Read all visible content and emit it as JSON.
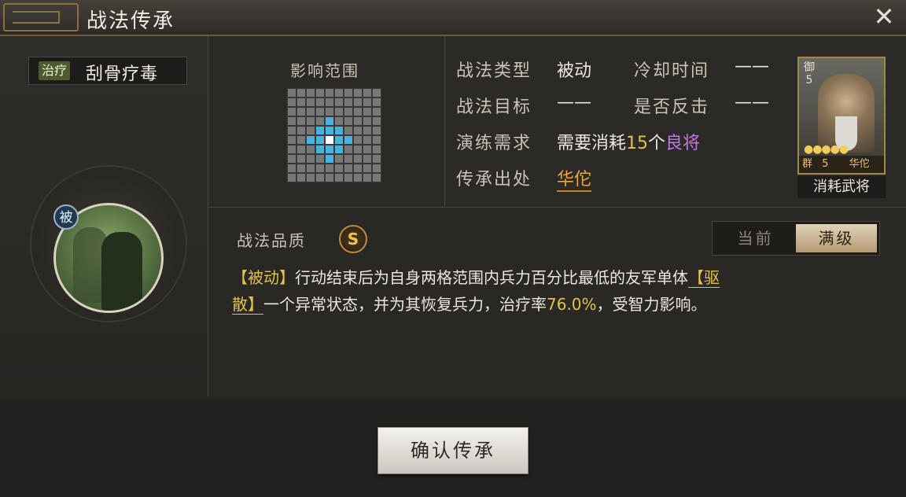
{
  "header": {
    "title": "战法传承"
  },
  "skill": {
    "tag": "治疗",
    "name": "刮骨疗毒",
    "passive_badge": "被"
  },
  "range": {
    "label": "影响范围",
    "grid_size": 10,
    "active_cells": [
      [
        3,
        4
      ],
      [
        4,
        3
      ],
      [
        4,
        4
      ],
      [
        4,
        5
      ],
      [
        5,
        2
      ],
      [
        5,
        3
      ],
      [
        5,
        5
      ],
      [
        5,
        6
      ],
      [
        6,
        3
      ],
      [
        6,
        4
      ],
      [
        6,
        5
      ],
      [
        7,
        4
      ]
    ],
    "center_cell": [
      5,
      4
    ]
  },
  "info": {
    "type_label": "战法类型",
    "type_value": "被动",
    "cooldown_label": "冷却时间",
    "cooldown_value": "——",
    "target_label": "战法目标",
    "target_value": "——",
    "counter_label": "是否反击",
    "counter_value": "——",
    "practice_label": "演练需求",
    "practice_prefix": "需要消耗",
    "practice_count": "15",
    "practice_unit": "个",
    "practice_item": "良将",
    "source_label": "传承出处",
    "source_value": "华佗"
  },
  "card": {
    "top_label": "御",
    "top_number": "5",
    "stars": "●●●●●",
    "faction": "群",
    "cost": "5",
    "name": "华佗",
    "caption": "消耗武将"
  },
  "quality": {
    "label": "战法品质",
    "grade": "S"
  },
  "level_toggle": {
    "current_label": "当前",
    "max_label": "满级",
    "selected": "满级"
  },
  "description": {
    "tag": "【被动】",
    "text1": "行动结束后为自身两格范围内兵力百分比最低的友军单体",
    "status_tag_1": "【驱",
    "status_tag_2": "散】",
    "text2": "一个异常状态，并为其恢复兵力，治疗率",
    "heal_rate": "76.0%",
    "text3": "，受智力影响。"
  },
  "footer": {
    "confirm_label": "确认传承"
  },
  "colors": {
    "accent_gold": "#e2c14b",
    "accent_purple": "#c774ea",
    "link_orange": "#f0a33a",
    "range_blue": "#47b2e0"
  }
}
